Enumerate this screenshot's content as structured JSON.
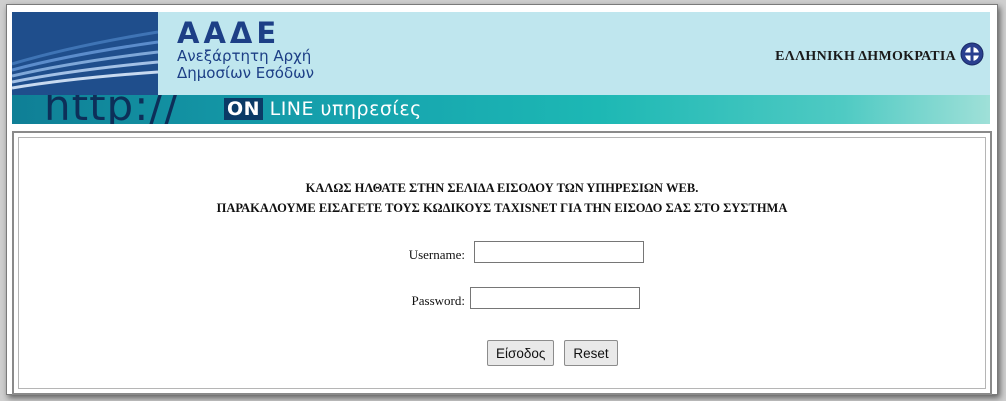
{
  "header": {
    "agency_abbr": "ΑΑΔΕ",
    "agency_line1": "Ανεξάρτητη Αρχή",
    "agency_line2": "Δημοσίων Εσόδων",
    "republic": "ΕΛΛΗΝΙΚΗ ΔΗΜΟΚΡΑΤΙΑ",
    "emblem_icon": "greek-emblem-icon"
  },
  "banner": {
    "http_text": "http://",
    "online_prefix": "ON",
    "online_rest": " LINE υπηρεσίες"
  },
  "main": {
    "welcome_line1": "ΚΑΛΩΣ ΗΛΘΑΤΕ ΣΤΗΝ ΣΕΛΙΔΑ ΕΙΣΟΔΟΥ ΤΩΝ ΥΠΗΡΕΣΙΩΝ WEB.",
    "welcome_line2": "ΠΑΡΑΚΑΛΟΥΜΕ ΕΙΣΑΓΕΤΕ ΤΟΥΣ ΚΩΔΙΚΟΥΣ TAXISNET ΓΙΑ ΤΗΝ ΕΙΣΟΔΟ ΣΑΣ ΣΤΟ ΣΥΣΤΗΜΑ"
  },
  "form": {
    "username_label": "Username:",
    "username_value": "",
    "password_label": "Password:",
    "password_value": "",
    "submit_label": "Είσοδος",
    "reset_label": "Reset"
  },
  "colors": {
    "header_bg": "#bfe6ee",
    "logo_bg": "#1f4e8c",
    "agency_text": "#1d3f86",
    "banner_start": "#0f7f96",
    "banner_end": "#9fe0d8"
  }
}
